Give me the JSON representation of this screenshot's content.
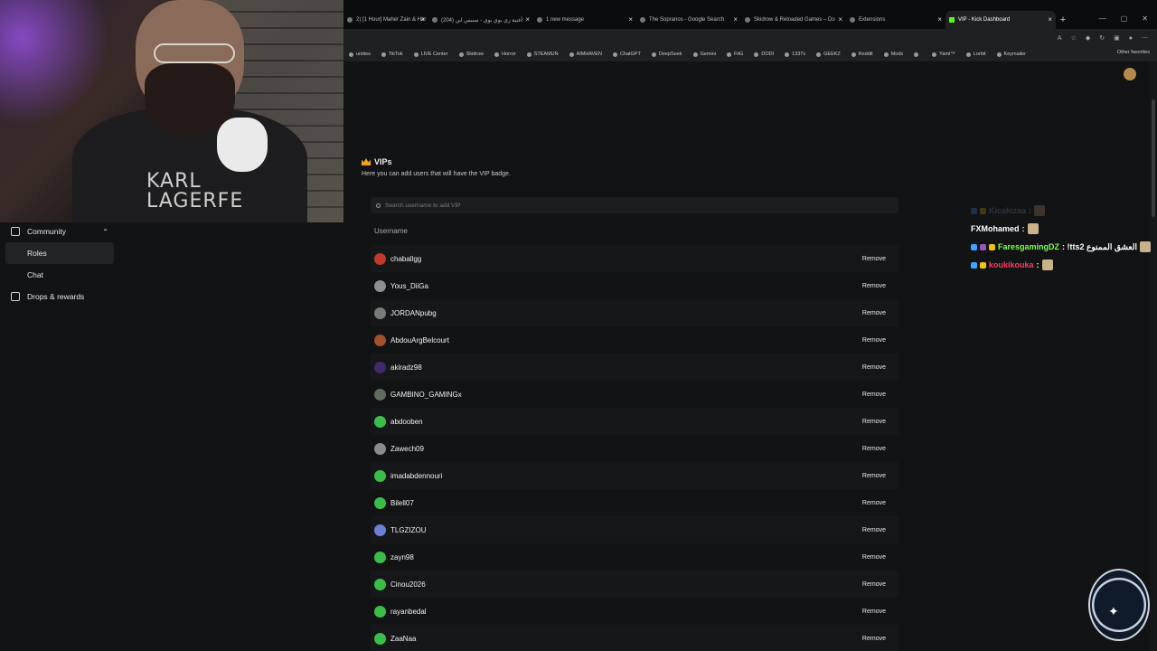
{
  "browser": {
    "tabs": [
      {
        "label": "2) [1 Hour] Maher Zain & Har",
        "active": false,
        "width": 94
      },
      {
        "label": "(204) أغنية زي بوي بوي - سيبس ابن",
        "active": false,
        "width": 116
      },
      {
        "label": "1 new message",
        "active": false,
        "width": 114
      },
      {
        "label": "The Sopranos - Google Search",
        "active": false,
        "width": 116
      },
      {
        "label": "Skidrow & Reloaded Games – Do",
        "active": false,
        "width": 116
      },
      {
        "label": "Extensions",
        "active": false,
        "width": 110
      },
      {
        "label": "VIP - Kick Dashboard",
        "active": true,
        "width": 122
      }
    ],
    "bookmarks": [
      "unities",
      "TikTok",
      "LIVE Center",
      "Skidrow",
      "Horror",
      "STEAMUN",
      "AIMHAVEN",
      "ChatGPT",
      "DeepSeek",
      "Gemini",
      "FitG",
      "DODI",
      "1337x",
      "GEEKZ",
      "Reddit",
      "Mods",
      "",
      "Yaml™",
      "Lorbit",
      "Keymailer"
    ],
    "other_bookmarks": "Other favorites"
  },
  "sidebar": {
    "community_label": "Community",
    "items": [
      {
        "label": "Roles",
        "active": true
      },
      {
        "label": "Chat",
        "active": false
      }
    ],
    "drops_label": "Drops & rewards"
  },
  "vips": {
    "title": "VIPs",
    "description": "Here you can add users that will have the VIP badge.",
    "search_placeholder": "Search username to add VIP",
    "column_header": "Username",
    "remove_label": "Remove",
    "users": [
      {
        "name": "chaballgg",
        "avatar_color": "#c0392b"
      },
      {
        "name": "Yous_DiiGa",
        "avatar_color": "#8e8e8e"
      },
      {
        "name": "JORDANpubg",
        "avatar_color": "#7a7a7a"
      },
      {
        "name": "AbdouArgBelcourt",
        "avatar_color": "#a0522d"
      },
      {
        "name": "akiradz98",
        "avatar_color": "#3d2b6b"
      },
      {
        "name": "GAMBINO_GAMINGx",
        "avatar_color": "#5f6b5f"
      },
      {
        "name": "abdooben",
        "avatar_color": "#3bbd4a"
      },
      {
        "name": "Zawech09",
        "avatar_color": "#8a8a8a"
      },
      {
        "name": "imadabdennouri",
        "avatar_color": "#3bbd4a"
      },
      {
        "name": "Bilell07",
        "avatar_color": "#3bbd4a"
      },
      {
        "name": "TLGZIZOU",
        "avatar_color": "#6b7fd7"
      },
      {
        "name": "zayn98",
        "avatar_color": "#3bbd4a"
      },
      {
        "name": "Cinou2026",
        "avatar_color": "#3bbd4a"
      },
      {
        "name": "rayanbedal",
        "avatar_color": "#3bbd4a"
      },
      {
        "name": "ZaaNaa",
        "avatar_color": "#3bbd4a"
      }
    ]
  },
  "chat": [
    {
      "user": "Kicakizaa",
      "message": ":",
      "user_color": "#8aa4c8",
      "faded": true,
      "badges": [
        "#3aa6ff",
        "#f1c40f"
      ]
    },
    {
      "user": "FXMohamed",
      "message": ":",
      "user_color": "#ffffff",
      "faded": false,
      "badges": []
    },
    {
      "user": "FaresgamingDZ",
      "message": ": !tts2 العشق الممنوع",
      "user_color": "#7cff4d",
      "faded": false,
      "badges": [
        "#3aa6ff",
        "#9b59b6",
        "#f1c40f"
      ]
    },
    {
      "user": "koukikouka",
      "message": ":",
      "user_color": "#ff3b5c",
      "faded": false,
      "badges": [
        "#3aa6ff",
        "#f1c40f"
      ]
    }
  ],
  "webcam": {
    "shirt_text_line1": "KARL",
    "shirt_text_line2": "LAGERFE"
  },
  "colors": {
    "kick_green": "#53fc18",
    "vip_crown": "#f1a322"
  }
}
